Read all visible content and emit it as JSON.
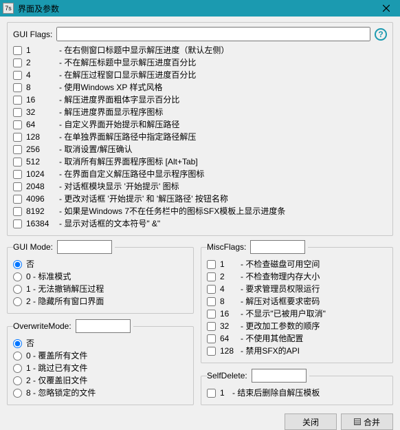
{
  "window": {
    "title": "界面及参数",
    "icon_label": "7s"
  },
  "guiFlags": {
    "label": "GUI Flags:",
    "value": "",
    "items": [
      {
        "num": "1",
        "desc": "- 在右侧窗口标题中显示解压进度（默认左侧）"
      },
      {
        "num": "2",
        "desc": "- 不在解压标题中显示解压进度百分比"
      },
      {
        "num": "4",
        "desc": "- 在解压过程窗口显示解压进度百分比"
      },
      {
        "num": "8",
        "desc": "- 使用Windows XP 样式风格"
      },
      {
        "num": "16",
        "desc": "- 解压进度界面粗体字显示百分比"
      },
      {
        "num": "32",
        "desc": "- 解压进度界面显示程序图标"
      },
      {
        "num": "64",
        "desc": "- 自定义界面开始提示和解压路径"
      },
      {
        "num": "128",
        "desc": "- 在单独界面解压路径中指定路径解压"
      },
      {
        "num": "256",
        "desc": "- 取消设置/解压确认"
      },
      {
        "num": "512",
        "desc": "- 取消所有解压界面程序图标 [Alt+Tab]"
      },
      {
        "num": "1024",
        "desc": "- 在界面自定义解压路径中显示程序图标"
      },
      {
        "num": "2048",
        "desc": "- 对话框模块显示 '开始提示' 图标"
      },
      {
        "num": "4096",
        "desc": "- 更改对话框 '开始提示' 和 '解压路径' 按钮名称"
      },
      {
        "num": "8192",
        "desc": "- 如果是Windows 7不在任务栏中的图标SFX模板上显示进度条"
      },
      {
        "num": "16384",
        "desc": "- 显示对话框的文本符号\" &\""
      }
    ]
  },
  "guiMode": {
    "label": "GUI Mode:",
    "value": "",
    "items": [
      {
        "label": "否"
      },
      {
        "label": "0 - 标准模式"
      },
      {
        "label": "1 - 无法撤销解压过程"
      },
      {
        "label": "2 - 隐藏所有窗口界面"
      }
    ],
    "selected": 0
  },
  "overwriteMode": {
    "label": "OverwriteMode:",
    "value": "",
    "items": [
      {
        "label": "否"
      },
      {
        "label": "0 - 覆盖所有文件"
      },
      {
        "label": "1 - 跳过已有文件"
      },
      {
        "label": "2 - 仅覆盖旧文件"
      },
      {
        "label": "8 - 忽略锁定的文件"
      }
    ],
    "selected": 0
  },
  "miscFlags": {
    "label": "MiscFlags:",
    "value": "",
    "items": [
      {
        "num": "1",
        "desc": "- 不检查磁盘可用空间"
      },
      {
        "num": "2",
        "desc": "- 不检查物理内存大小"
      },
      {
        "num": "4",
        "desc": "- 要求管理员权限运行"
      },
      {
        "num": "8",
        "desc": "- 解压对话框要求密码"
      },
      {
        "num": "16",
        "desc": "- 不显示\"已被用户取消\""
      },
      {
        "num": "32",
        "desc": "- 更改加工参数的顺序"
      },
      {
        "num": "64",
        "desc": "- 不使用其他配置"
      },
      {
        "num": "128",
        "desc": "- 禁用SFX的API"
      }
    ]
  },
  "selfDelete": {
    "label": "SelfDelete:",
    "value": "",
    "item": {
      "num": "1",
      "desc": "- 结束后删除自解压模板"
    }
  },
  "buttons": {
    "close": "关闭",
    "merge": "合并"
  }
}
